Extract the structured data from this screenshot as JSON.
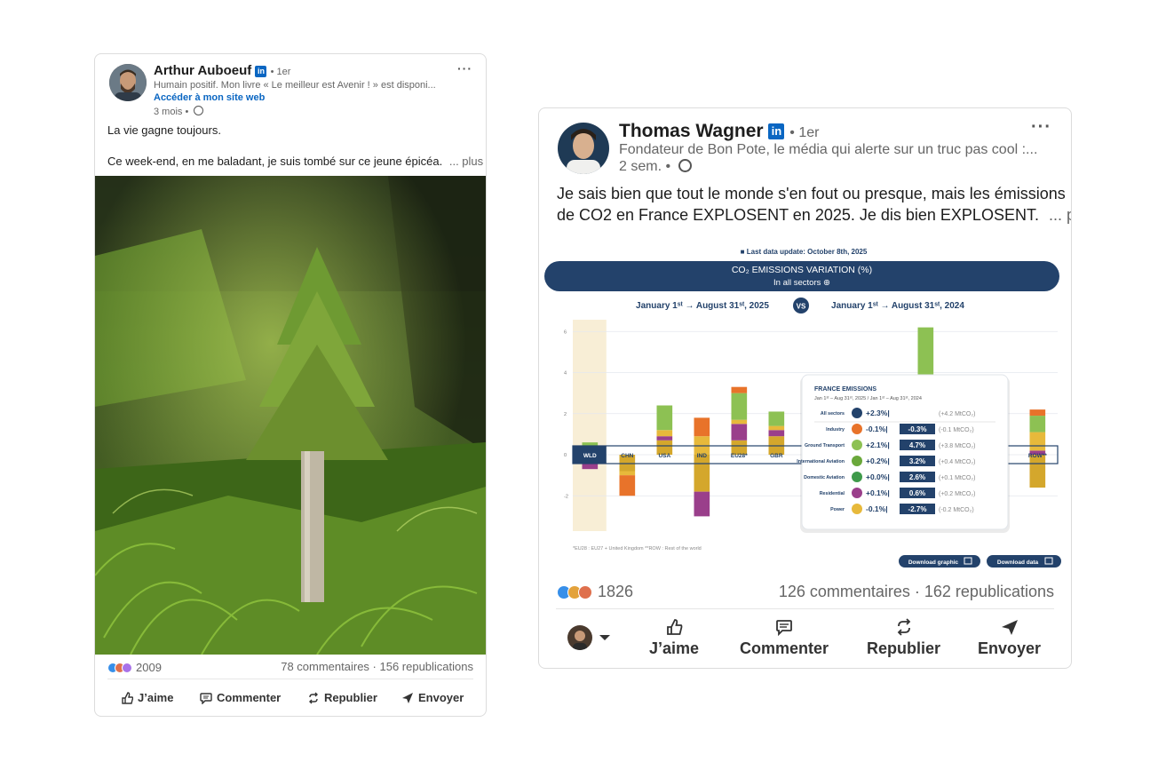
{
  "post1": {
    "author": "Arthur Auboeuf",
    "degree": "• 1er",
    "headline": "Humain positif. Mon livre « Le meilleur est Avenir ! » est disponi...",
    "website_link": "Accéder à mon site web",
    "time": "3 mois •",
    "text_line1": "La vie gagne toujours.",
    "text_line2": "Ce week-end, en me baladant, je suis tombé sur ce jeune épicéa.",
    "more": "... plus",
    "reaction_count": "2009",
    "comments_reposts": "78 commentaires · 156 republications",
    "actions": {
      "like": "J’aime",
      "comment": "Commenter",
      "repost": "Republier",
      "send": "Envoyer"
    }
  },
  "post2": {
    "author": "Thomas Wagner",
    "degree": "• 1er",
    "headline": "Fondateur de Bon Pote, le média qui alerte sur un truc pas cool :...",
    "time": "2 sem. •",
    "text_line1": "Je sais bien que tout le monde s'en fout ou presque, mais les émissions",
    "text_line2": "de CO2 en France EXPLOSENT en 2025. Je dis bien EXPLOSENT.",
    "more": "... plus",
    "reaction_count": "1826",
    "comments_reposts": "126 commentaires · 162 republications",
    "actions": {
      "like": "J’aime",
      "comment": "Commenter",
      "repost": "Republier",
      "send": "Envoyer"
    }
  },
  "chart_data": {
    "type": "bar",
    "update_note": "Last data update: October 8th, 2025",
    "title": "CO₂ EMISSIONS VARIATION (%)",
    "subtitle": "In all sectors ⊕",
    "period_a": "January 1ˢᵗ → August 31ˢᵗ, 2025",
    "vs": "VS",
    "period_b": "January 1ˢᵗ → August 31ˢᵗ, 2024",
    "categories": [
      "WLD",
      "CHN",
      "USA",
      "IND",
      "EU28*",
      "GBR",
      "FRA",
      "",
      "",
      "",
      "",
      "A",
      "ROW**"
    ],
    "visible_categories": [
      "WLD",
      "CHN",
      "USA",
      "IND",
      "EU28*",
      "GBR",
      "FRA",
      "A",
      "ROW**"
    ],
    "yticks": [
      "6",
      "4",
      "2",
      "0",
      "-2"
    ],
    "ylim": [
      -3.2,
      6.4
    ],
    "footnote": "*EU28 : EU27 + United Kingdom    **ROW : Rest of the world",
    "buttons": [
      "Download graphic",
      "Download data"
    ],
    "colors": {
      "industry": "#e8732a",
      "ground_transport": "#e7b93b",
      "international_aviation": "#8dc153",
      "domestic_aviation": "#6aa83b",
      "residential": "#9a3f8b",
      "power": "#d4a72c",
      "header": "#23426b",
      "wld_band": "#f8eed6"
    },
    "series": [
      {
        "name": "Power",
        "values": [
          0.2,
          -0.8,
          0.7,
          -1.8,
          0.7,
          0.9,
          0.0,
          0,
          0,
          0,
          0,
          0.3,
          -1.6
        ]
      },
      {
        "name": "Residential",
        "values": [
          0.1,
          0.0,
          0.2,
          0.0,
          0.8,
          0.3,
          0.2,
          0,
          0,
          0,
          0,
          0.3,
          0.2
        ]
      },
      {
        "name": "Ground Transport",
        "values": [
          0.1,
          -0.2,
          0.3,
          0.9,
          0.2,
          0.2,
          0.9,
          0,
          0,
          0,
          0,
          0.2,
          0.9
        ]
      },
      {
        "name": "International Aviation",
        "values": [
          0.2,
          0.0,
          1.2,
          0.0,
          1.3,
          0.7,
          1.6,
          0,
          0,
          0,
          0,
          0.2,
          0.8
        ]
      },
      {
        "name": "Industry",
        "values": [
          -0.1,
          -1.0,
          0.0,
          0.9,
          0.3,
          0.0,
          0.0,
          0,
          0,
          0,
          0,
          0.1,
          0.3
        ]
      },
      {
        "name": "Power (negative)",
        "values": [
          -0.6,
          0.0,
          0.0,
          -1.2,
          0.0,
          0.0,
          0.0,
          0,
          0,
          0,
          0,
          0,
          0
        ]
      }
    ],
    "extra_positive_bars": [
      {
        "category_index": 9,
        "value": 6.2,
        "color": "#8dc153"
      },
      {
        "category_index": 8,
        "value": 2.8,
        "color": "#8dc153"
      }
    ],
    "france_panel": {
      "title": "FRANCE EMISSIONS",
      "period": "Jan 1ˢᵗ – Aug 31ˢᵗ, 2025 / Jan 1ˢᵗ – Aug 31ˢᵗ, 2024",
      "rows": [
        {
          "label": "All sectors",
          "change": "+2.3%",
          "share": "",
          "abs": "(+4.2 MtCO₂)",
          "color": "#23426b"
        },
        {
          "label": "Industry",
          "change": "-0.1%",
          "share": "-0.3%",
          "abs": "(-0.1 MtCO₂)",
          "color": "#e8732a"
        },
        {
          "label": "Ground Transport",
          "change": "+2.1%",
          "share": "4.7%",
          "abs": "(+3.8 MtCO₂)",
          "color": "#8dc153"
        },
        {
          "label": "International Aviation",
          "change": "+0.2%",
          "share": "3.2%",
          "abs": "(+0.4 MtCO₂)",
          "color": "#6aa83b"
        },
        {
          "label": "Domestic Aviation",
          "change": "+0.0%",
          "share": "2.6%",
          "abs": "(+0.1 MtCO₂)",
          "color": "#3f9a4a"
        },
        {
          "label": "Residential",
          "change": "+0.1%",
          "share": "0.6%",
          "abs": "(+0.2 MtCO₂)",
          "color": "#9a3f8b"
        },
        {
          "label": "Power",
          "change": "-0.1%",
          "share": "-2.7%",
          "abs": "(-0.2 MtCO₂)",
          "color": "#e7b93b"
        }
      ]
    }
  }
}
